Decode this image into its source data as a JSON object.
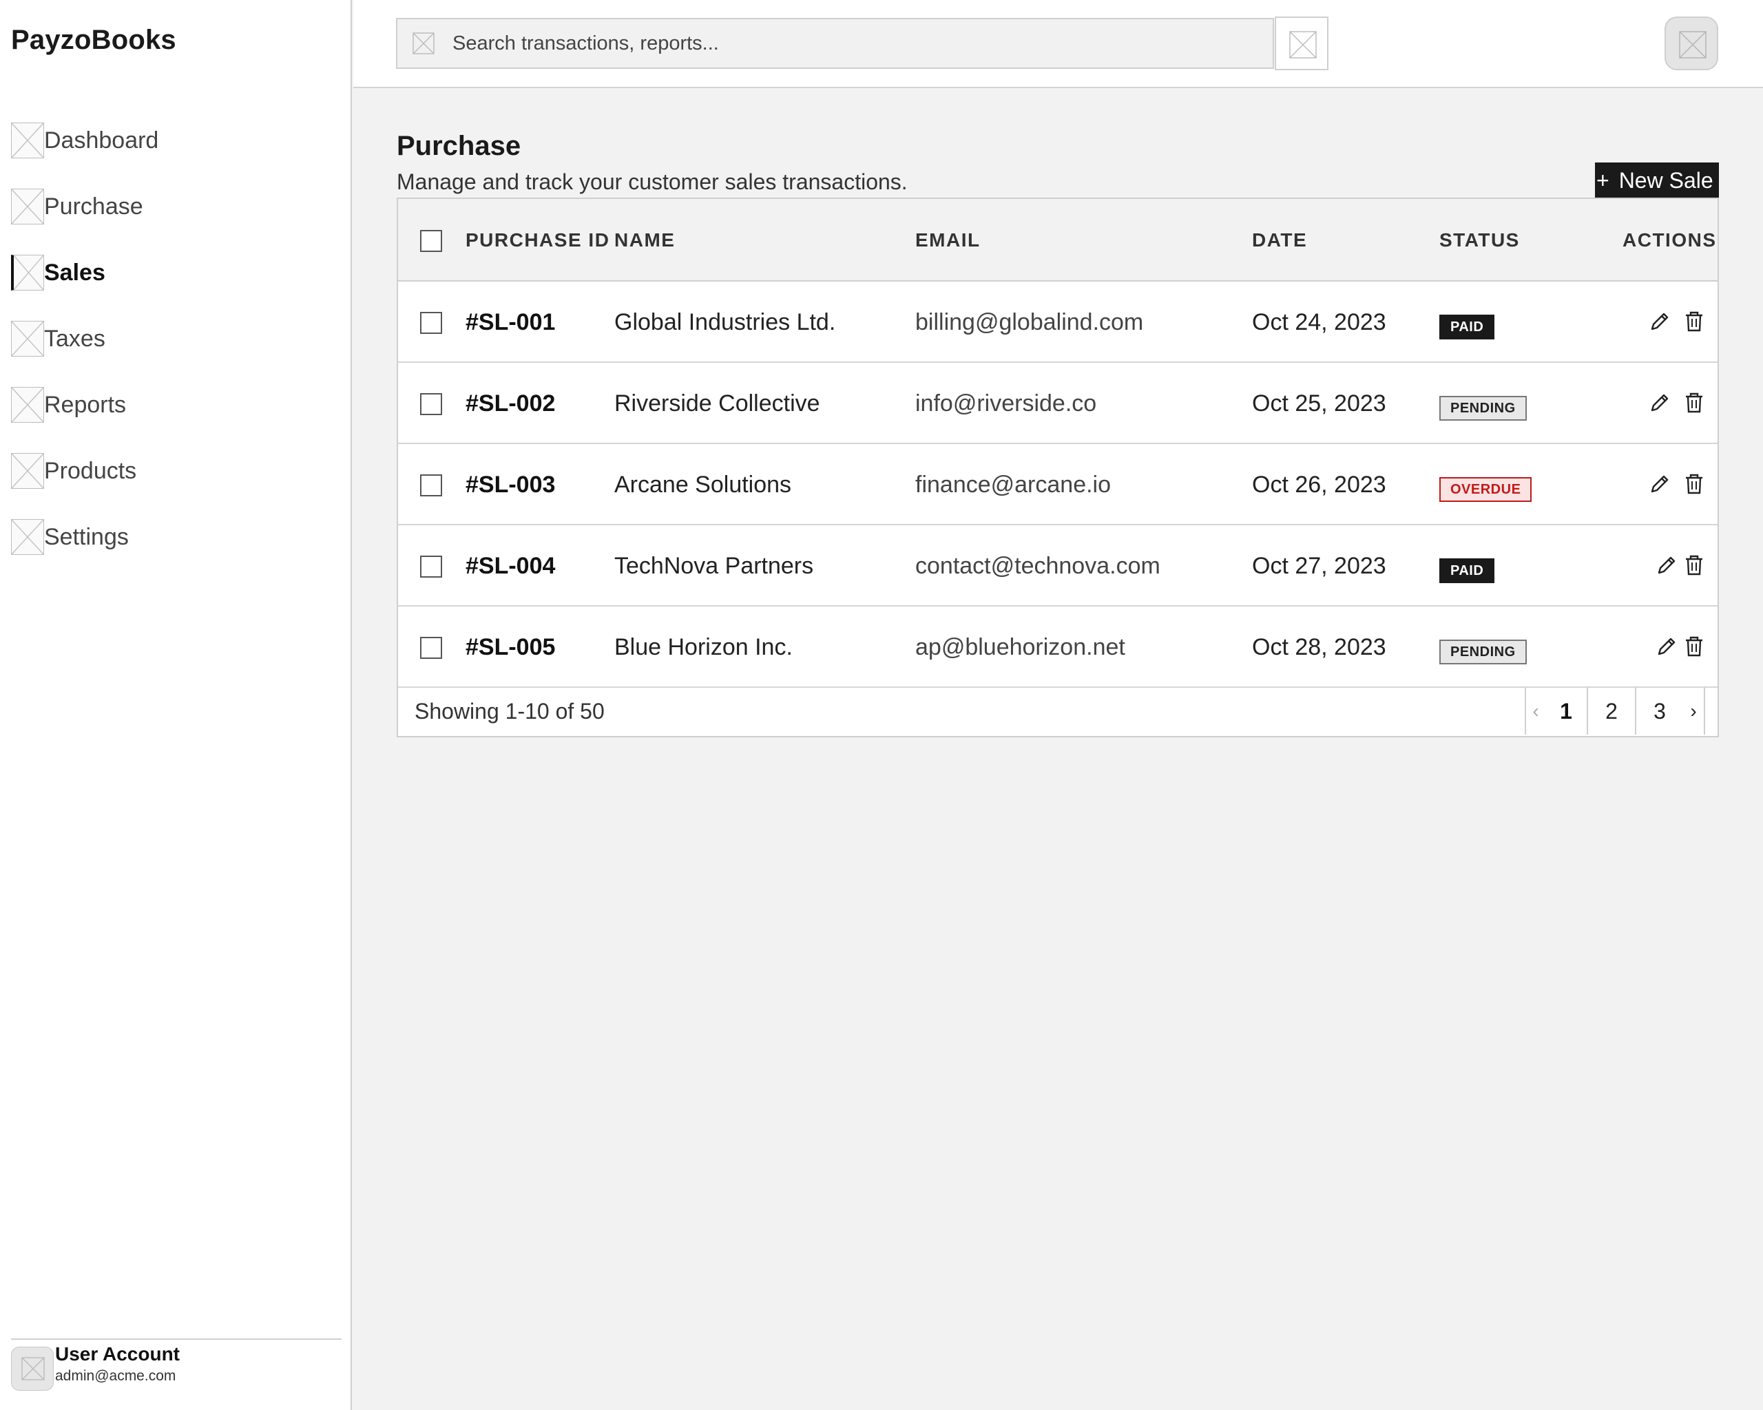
{
  "app": {
    "brand": "PayzoBooks"
  },
  "sidebar": {
    "items": [
      {
        "label": "Dashboard",
        "active": false
      },
      {
        "label": "Purchase",
        "active": false
      },
      {
        "label": "Sales",
        "active": true
      },
      {
        "label": "Taxes",
        "active": false
      },
      {
        "label": "Reports",
        "active": false
      },
      {
        "label": "Products",
        "active": false
      },
      {
        "label": "Settings",
        "active": false
      }
    ],
    "user": {
      "name": "User Account",
      "email": "admin@acme.com"
    }
  },
  "topbar": {
    "search_placeholder": "Search transactions, reports..."
  },
  "page": {
    "title": "Purchase",
    "subtitle": "Manage and track your customer sales transactions.",
    "new_button_plus": "+",
    "new_button_label": "New Sale"
  },
  "table": {
    "headers": {
      "id": "PURCHASE ID",
      "name": "NAME",
      "email": "EMAIL",
      "date": "DATE",
      "status": "STATUS",
      "actions": "ACTIONS"
    },
    "rows": [
      {
        "id": "#SL-001",
        "name": "Global Industries Ltd.",
        "email": "billing@globalind.com",
        "date": "Oct 24, 2023",
        "status": "PAID",
        "status_kind": "paid"
      },
      {
        "id": "#SL-002",
        "name": "Riverside Collective",
        "email": "info@riverside.co",
        "date": "Oct 25, 2023",
        "status": "PENDING",
        "status_kind": "pending"
      },
      {
        "id": "#SL-003",
        "name": "Arcane Solutions",
        "email": "finance@arcane.io",
        "date": "Oct 26, 2023",
        "status": "OVERDUE",
        "status_kind": "overdue"
      },
      {
        "id": "#SL-004",
        "name": "TechNova Partners",
        "email": "contact@technova.com",
        "date": "Oct 27, 2023",
        "status": "PAID",
        "status_kind": "paid"
      },
      {
        "id": "#SL-005",
        "name": "Blue Horizon Inc.",
        "email": "ap@bluehorizon.net",
        "date": "Oct 28, 2023",
        "status": "PENDING",
        "status_kind": "pending"
      }
    ],
    "footer": {
      "showing": "Showing 1-10 of 50",
      "prev": "‹",
      "pages": [
        "1",
        "2",
        "3"
      ],
      "current_page": "1",
      "next": "›"
    }
  },
  "colors": {
    "accent": "#1a1a1a",
    "overdue": "#c21a1a",
    "overdue_bg": "#fbe3e3",
    "pending_bg": "#e8e8e8",
    "background": "#f2f2f2"
  },
  "icons": {
    "nav": "image-placeholder-icon",
    "search": "image-placeholder-icon",
    "edit": "pencil-icon",
    "delete": "trash-icon"
  }
}
